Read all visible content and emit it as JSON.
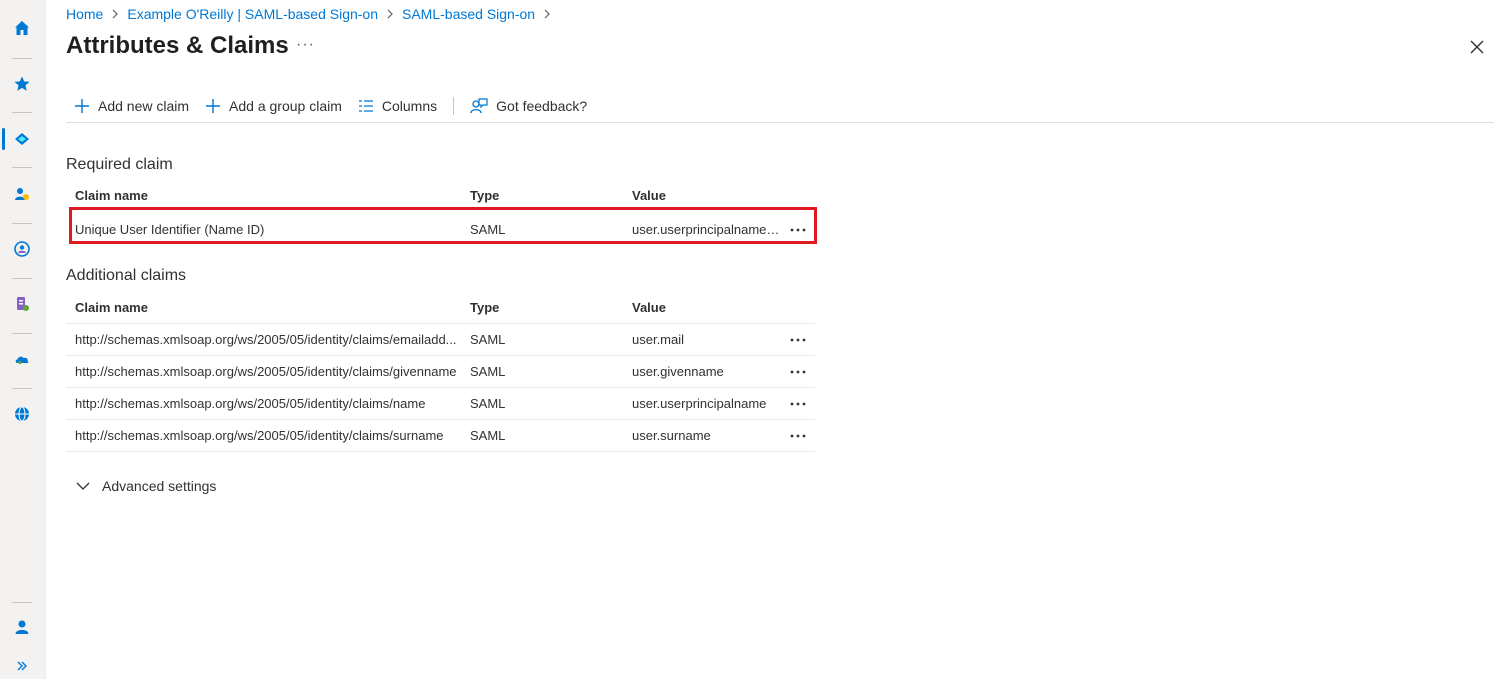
{
  "breadcrumb": {
    "items": [
      "Home",
      "Example O'Reilly | SAML-based Sign-on",
      "SAML-based Sign-on"
    ]
  },
  "page": {
    "title": "Attributes & Claims",
    "more_label": "···"
  },
  "toolbar": {
    "add_claim": "Add new claim",
    "add_group_claim": "Add a group claim",
    "columns": "Columns",
    "feedback": "Got feedback?"
  },
  "required": {
    "section_title": "Required claim",
    "headers": {
      "name": "Claim name",
      "type": "Type",
      "value": "Value"
    },
    "rows": [
      {
        "name": "Unique User Identifier (Name ID)",
        "type": "SAML",
        "value": "user.userprincipalname [..."
      }
    ]
  },
  "additional": {
    "section_title": "Additional claims",
    "headers": {
      "name": "Claim name",
      "type": "Type",
      "value": "Value"
    },
    "rows": [
      {
        "name": "http://schemas.xmlsoap.org/ws/2005/05/identity/claims/emailadd...",
        "type": "SAML",
        "value": "user.mail"
      },
      {
        "name": "http://schemas.xmlsoap.org/ws/2005/05/identity/claims/givenname",
        "type": "SAML",
        "value": "user.givenname"
      },
      {
        "name": "http://schemas.xmlsoap.org/ws/2005/05/identity/claims/name",
        "type": "SAML",
        "value": "user.userprincipalname"
      },
      {
        "name": "http://schemas.xmlsoap.org/ws/2005/05/identity/claims/surname",
        "type": "SAML",
        "value": "user.surname"
      }
    ]
  },
  "advanced": {
    "label": "Advanced settings"
  },
  "colors": {
    "accent": "#0078d4",
    "highlight": "#e01a22"
  },
  "rail_icons": [
    "home-icon",
    "favorites-star-icon",
    "entra-id-icon",
    "users-icon",
    "groups-icon",
    "enterprise-apps-icon",
    "cloud-icon",
    "globe-icon",
    "user-profile-icon",
    "expand-menu-icon"
  ]
}
